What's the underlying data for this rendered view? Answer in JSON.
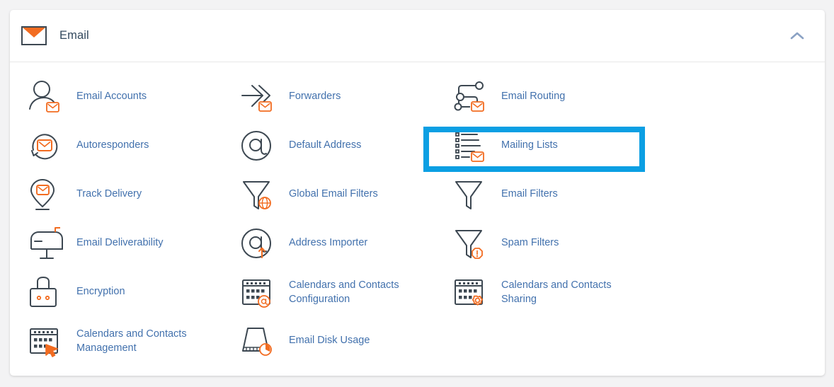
{
  "header": {
    "title": "Email",
    "icon": "envelope-icon",
    "collapse_icon": "chevron-up-icon",
    "accent_orange": "#f26c21",
    "title_color": "#33495e"
  },
  "theme": {
    "link_blue": "#4271ad",
    "icon_stroke": "#3d4852",
    "highlight_blue": "#0b9fe3",
    "card_background": "#ffffff",
    "page_background": "#f3f3f4"
  },
  "items": [
    {
      "label": "Email Accounts",
      "icon": "user-envelope-icon",
      "highlighted": false
    },
    {
      "label": "Forwarders",
      "icon": "arrow-forward-envelope-icon",
      "highlighted": false
    },
    {
      "label": "Email Routing",
      "icon": "routing-nodes-envelope-icon",
      "highlighted": false
    },
    {
      "label": "Autoresponders",
      "icon": "refresh-envelope-icon",
      "highlighted": false
    },
    {
      "label": "Default Address",
      "icon": "at-circle-icon",
      "highlighted": false
    },
    {
      "label": "Mailing Lists",
      "icon": "list-envelope-icon",
      "highlighted": true
    },
    {
      "label": "Track Delivery",
      "icon": "map-pin-envelope-icon",
      "highlighted": false
    },
    {
      "label": "Global Email Filters",
      "icon": "funnel-globe-icon",
      "highlighted": false
    },
    {
      "label": "Email Filters",
      "icon": "funnel-icon",
      "highlighted": false
    },
    {
      "label": "Email Deliverability",
      "icon": "mailbox-icon",
      "highlighted": false
    },
    {
      "label": "Address Importer",
      "icon": "at-upload-icon",
      "highlighted": false
    },
    {
      "label": "Spam Filters",
      "icon": "funnel-alert-icon",
      "highlighted": false
    },
    {
      "label": "Encryption",
      "icon": "padlock-icon",
      "highlighted": false
    },
    {
      "label": "Calendars and Contacts Configuration",
      "icon": "calendar-at-icon",
      "highlighted": false
    },
    {
      "label": "Calendars and Contacts Sharing",
      "icon": "calendar-gear-icon",
      "highlighted": false
    },
    {
      "label": "Calendars and Contacts Management",
      "icon": "calendar-cursor-icon",
      "highlighted": false
    },
    {
      "label": "Email Disk Usage",
      "icon": "disk-pie-icon",
      "highlighted": false
    }
  ]
}
